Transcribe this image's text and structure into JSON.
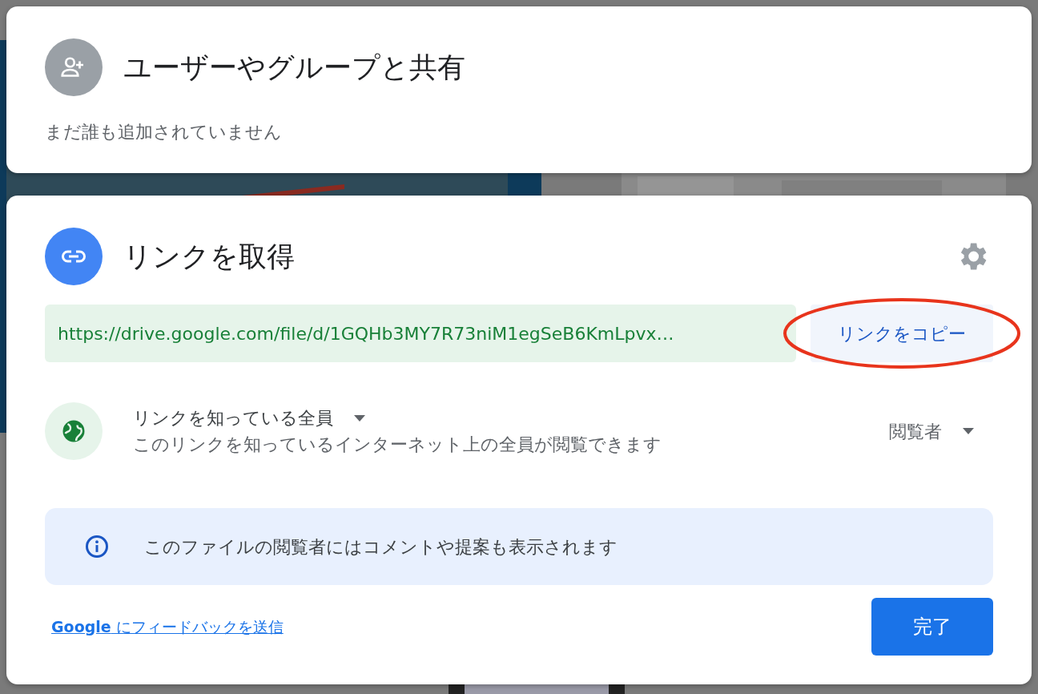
{
  "share_people": {
    "title": "ユーザーやグループと共有",
    "subtitle": "まだ誰も追加されていません"
  },
  "get_link": {
    "title": "リンクを取得",
    "url": "https://drive.google.com/file/d/1GQHb3MY7R73niM1egSeB6KmLpvx…",
    "copy_button": "リンクをコピー",
    "copy_highlighted": true,
    "access": {
      "scope": "リンクを知っている全員",
      "description": "このリンクを知っているインターネット上の全員が閲覧できます",
      "role": "閲覧者"
    },
    "notice": "このファイルの閲覧者にはコメントや提案も表示されます",
    "feedback_link": {
      "brand": "Google",
      "text": " にフィードバックを送信"
    },
    "done_button": "完了"
  }
}
